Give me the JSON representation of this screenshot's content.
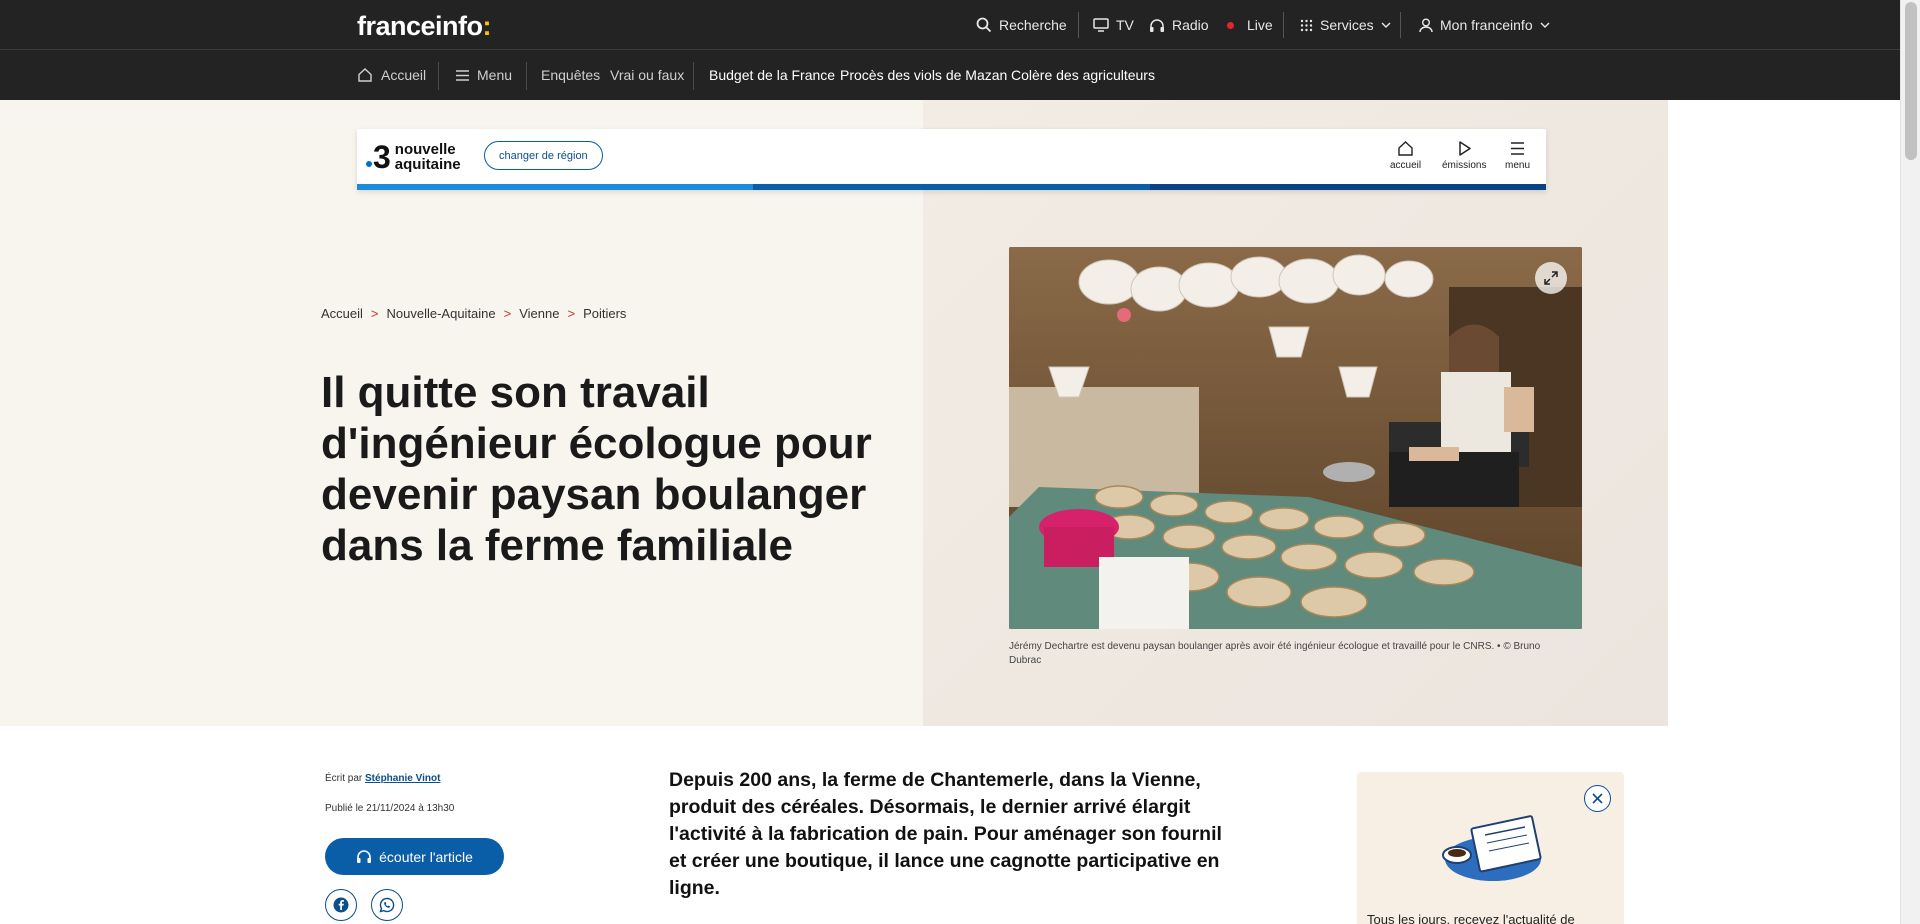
{
  "header": {
    "logo_text": "franceinfo",
    "logo_colon": ":",
    "search_label": "Recherche",
    "tv_label": "TV",
    "radio_label": "Radio",
    "live_label": "Live",
    "services_label": "Services",
    "account_label": "Mon franceinfo"
  },
  "nav": {
    "home_label": "Accueil",
    "menu_label": "Menu",
    "items": [
      "Enquêtes",
      "Vrai ou faux"
    ],
    "topics": [
      "Budget de la France",
      "Procès des viols de Mazan",
      "Colère des agriculteurs"
    ]
  },
  "region": {
    "number": "3",
    "name_line1": "nouvelle",
    "name_line2": "aquitaine",
    "change_button": "changer de région",
    "tools": [
      "accueil",
      "émissions",
      "menu"
    ],
    "stripe_colors": [
      "#1d8cd8",
      "#0a5ea8",
      "#0b4283"
    ]
  },
  "breadcrumb": [
    "Accueil",
    "Nouvelle-Aquitaine",
    "Vienne",
    "Poitiers"
  ],
  "breadcrumb_sep": ">",
  "article": {
    "title": "Il quitte son travail d'ingénieur écologue pour devenir paysan boulanger dans la ferme familiale",
    "caption": "Jérémy Dechartre est devenu paysan boulanger après avoir été ingénieur écologue et travaillé pour le CNRS. • © Bruno Dubrac",
    "byline_prefix": "Écrit par",
    "author": "Stéphanie Vinot",
    "published": "Publié le 21/11/2024 à 13h30",
    "listen_label": "écouter l'article",
    "chapo": "Depuis 200 ans, la ferme de Chantemerle, dans la Vienne, produit des céréales. Désormais, le dernier arrivé élargit l'activité à la fabrication de pain. Pour aménager son fournil et créer une boutique, il lance une cagnotte participative en ligne."
  },
  "promo": {
    "text": "Tous les jours, recevez l'actualité de"
  },
  "colors": {
    "bar": "#232323",
    "accent_blue": "#0a5ea8",
    "live_red": "#e0272b",
    "logo_yellow": "#fcc400"
  }
}
